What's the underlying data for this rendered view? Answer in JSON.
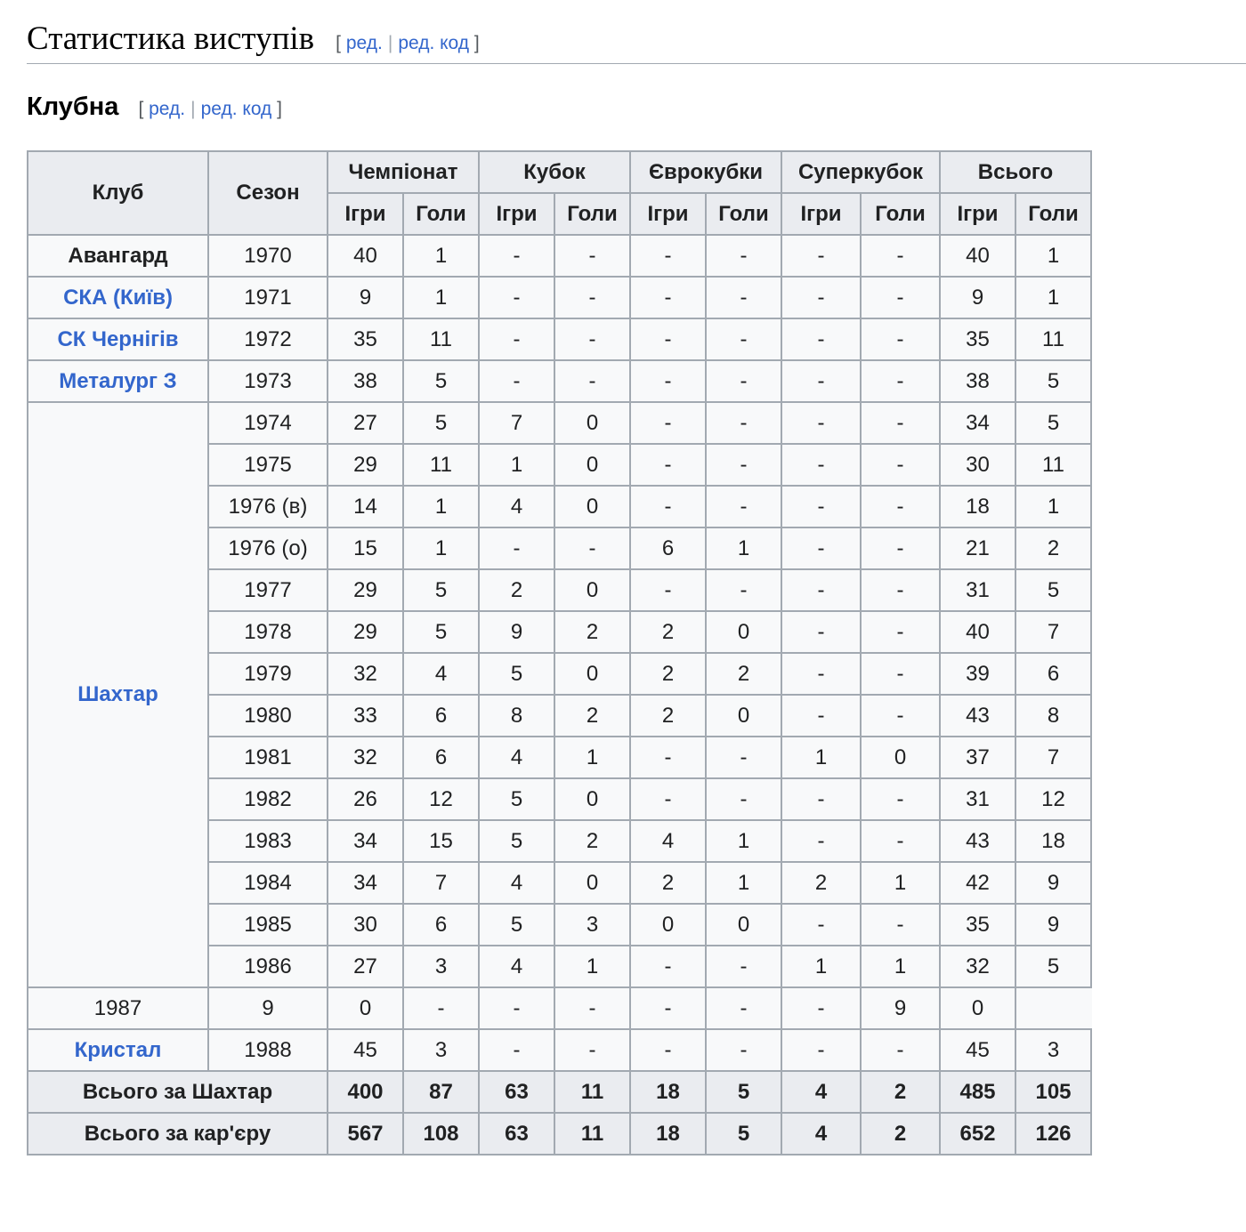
{
  "section": {
    "title": "Статистика виступів",
    "edit": {
      "open": "[",
      "edit_label": "ред.",
      "sep": "|",
      "code_label": "ред. код",
      "close": "]"
    }
  },
  "subsection": {
    "title": "Клубна",
    "edit": {
      "open": "[",
      "edit_label": "ред.",
      "sep": "|",
      "code_label": "ред. код",
      "close": "]"
    }
  },
  "table": {
    "header": {
      "club": "Клуб",
      "season": "Сезон",
      "groups": [
        "Чемпіонат",
        "Кубок",
        "Єврокубки",
        "Суперкубок",
        "Всього"
      ],
      "sub": [
        "Ігри",
        "Голи"
      ]
    },
    "rows": [
      {
        "club": "Авангард",
        "club_link": false,
        "season": "1970",
        "v": [
          "40",
          "1",
          "-",
          "-",
          "-",
          "-",
          "-",
          "-",
          "40",
          "1"
        ]
      },
      {
        "club": "СКА (Київ)",
        "club_link": true,
        "season": "1971",
        "v": [
          "9",
          "1",
          "-",
          "-",
          "-",
          "-",
          "-",
          "-",
          "9",
          "1"
        ]
      },
      {
        "club": "СК Чернігів",
        "club_link": true,
        "season": "1972",
        "v": [
          "35",
          "11",
          "-",
          "-",
          "-",
          "-",
          "-",
          "-",
          "35",
          "11"
        ]
      },
      {
        "club": "Металург З",
        "club_link": true,
        "season": "1973",
        "v": [
          "38",
          "5",
          "-",
          "-",
          "-",
          "-",
          "-",
          "-",
          "38",
          "5"
        ]
      },
      {
        "club": "Шахтар",
        "club_link": true,
        "club_rowspan": 14,
        "season": "1974",
        "v": [
          "27",
          "5",
          "7",
          "0",
          "-",
          "-",
          "-",
          "-",
          "34",
          "5"
        ]
      },
      {
        "season": "1975",
        "v": [
          "29",
          "11",
          "1",
          "0",
          "-",
          "-",
          "-",
          "-",
          "30",
          "11"
        ]
      },
      {
        "season": "1976 (в)",
        "v": [
          "14",
          "1",
          "4",
          "0",
          "-",
          "-",
          "-",
          "-",
          "18",
          "1"
        ]
      },
      {
        "season": "1976 (о)",
        "v": [
          "15",
          "1",
          "-",
          "-",
          "6",
          "1",
          "-",
          "-",
          "21",
          "2"
        ]
      },
      {
        "season": "1977",
        "v": [
          "29",
          "5",
          "2",
          "0",
          "-",
          "-",
          "-",
          "-",
          "31",
          "5"
        ]
      },
      {
        "season": "1978",
        "v": [
          "29",
          "5",
          "9",
          "2",
          "2",
          "0",
          "-",
          "-",
          "40",
          "7"
        ]
      },
      {
        "season": "1979",
        "v": [
          "32",
          "4",
          "5",
          "0",
          "2",
          "2",
          "-",
          "-",
          "39",
          "6"
        ]
      },
      {
        "season": "1980",
        "v": [
          "33",
          "6",
          "8",
          "2",
          "2",
          "0",
          "-",
          "-",
          "43",
          "8"
        ]
      },
      {
        "season": "1981",
        "v": [
          "32",
          "6",
          "4",
          "1",
          "-",
          "-",
          "1",
          "0",
          "37",
          "7"
        ]
      },
      {
        "season": "1982",
        "v": [
          "26",
          "12",
          "5",
          "0",
          "-",
          "-",
          "-",
          "-",
          "31",
          "12"
        ]
      },
      {
        "season": "1983",
        "v": [
          "34",
          "15",
          "5",
          "2",
          "4",
          "1",
          "-",
          "-",
          "43",
          "18"
        ]
      },
      {
        "season": "1984",
        "v": [
          "34",
          "7",
          "4",
          "0",
          "2",
          "1",
          "2",
          "1",
          "42",
          "9"
        ]
      },
      {
        "season": "1985",
        "v": [
          "30",
          "6",
          "5",
          "3",
          "0",
          "0",
          "-",
          "-",
          "35",
          "9"
        ]
      },
      {
        "season": "1986",
        "v": [
          "27",
          "3",
          "4",
          "1",
          "-",
          "-",
          "1",
          "1",
          "32",
          "5"
        ]
      },
      {
        "season": "1987",
        "v": [
          "9",
          "0",
          "-",
          "-",
          "-",
          "-",
          "-",
          "-",
          "9",
          "0"
        ]
      },
      {
        "club": "Кристал",
        "club_link": true,
        "season": "1988",
        "v": [
          "45",
          "3",
          "-",
          "-",
          "-",
          "-",
          "-",
          "-",
          "45",
          "3"
        ]
      }
    ],
    "totals": [
      {
        "label": "Всього за Шахтар",
        "v": [
          "400",
          "87",
          "63",
          "11",
          "18",
          "5",
          "4",
          "2",
          "485",
          "105"
        ]
      },
      {
        "label": "Всього за кар'єру",
        "v": [
          "567",
          "108",
          "63",
          "11",
          "18",
          "5",
          "4",
          "2",
          "652",
          "126"
        ]
      }
    ]
  }
}
